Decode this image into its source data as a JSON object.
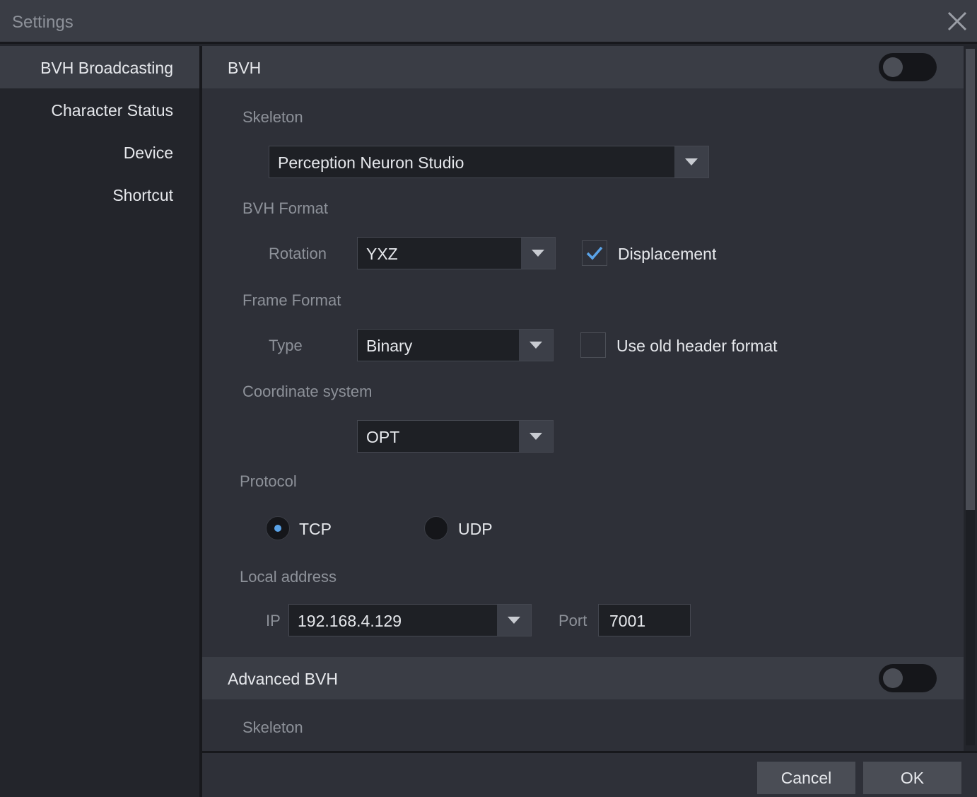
{
  "window": {
    "title": "Settings"
  },
  "sidebar": {
    "items": [
      {
        "label": "BVH Broadcasting"
      },
      {
        "label": "Character Status"
      },
      {
        "label": "Device"
      },
      {
        "label": "Shortcut"
      }
    ],
    "active": "BVH Broadcasting"
  },
  "bvh": {
    "header": "BVH",
    "enabled": false,
    "skeleton_label": "Skeleton",
    "skeleton_value": "Perception Neuron Studio",
    "bvh_format_label": "BVH Format",
    "rotation_label": "Rotation",
    "rotation_value": "YXZ",
    "displacement_label": "Displacement",
    "displacement_checked": true,
    "frame_format_label": "Frame Format",
    "type_label": "Type",
    "type_value": "Binary",
    "old_header_label": "Use old header format",
    "old_header_checked": false,
    "coord_label": "Coordinate system",
    "coord_value": "OPT",
    "protocol_label": "Protocol",
    "protocol_options": [
      "TCP",
      "UDP"
    ],
    "protocol_selected": "TCP",
    "local_address_label": "Local address",
    "ip_label": "IP",
    "ip_value": "192.168.4.129",
    "port_label": "Port",
    "port_value": "7001"
  },
  "advanced_bvh": {
    "header": "Advanced BVH",
    "enabled": false,
    "skeleton_label": "Skeleton"
  },
  "footer": {
    "cancel_label": "Cancel",
    "ok_label": "OK"
  },
  "colors": {
    "accent": "#5aa3e8",
    "panel": "#2e3038",
    "header": "#3a3d45"
  }
}
